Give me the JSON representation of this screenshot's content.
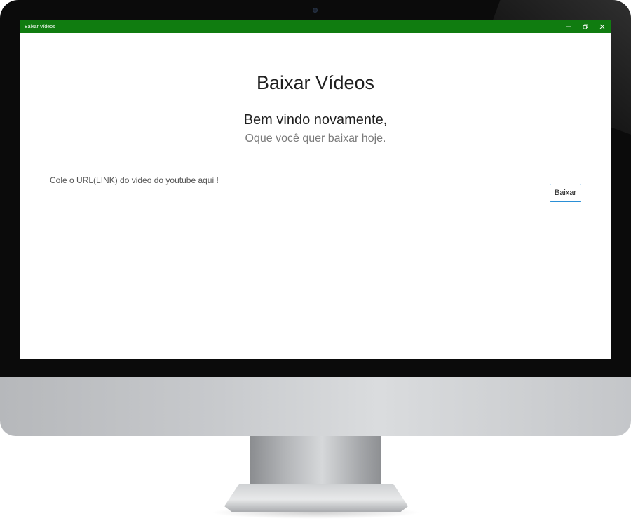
{
  "window": {
    "title": "Baixar Vídeos",
    "controls": {
      "minimize_icon": "minimize-icon",
      "restore_icon": "restore-icon",
      "close_icon": "close-icon"
    }
  },
  "main": {
    "heading": "Baixar Vídeos",
    "welcome": "Bem vindo novamente,",
    "subtitle": "Oque você quer baixar hoje.",
    "url_input": {
      "value": "",
      "placeholder": "Cole o URL(LINK) do video do youtube aqui !"
    },
    "download_button_label": "Baixar"
  },
  "colors": {
    "titlebar": "#107c10",
    "accent": "#2a8fd6"
  }
}
